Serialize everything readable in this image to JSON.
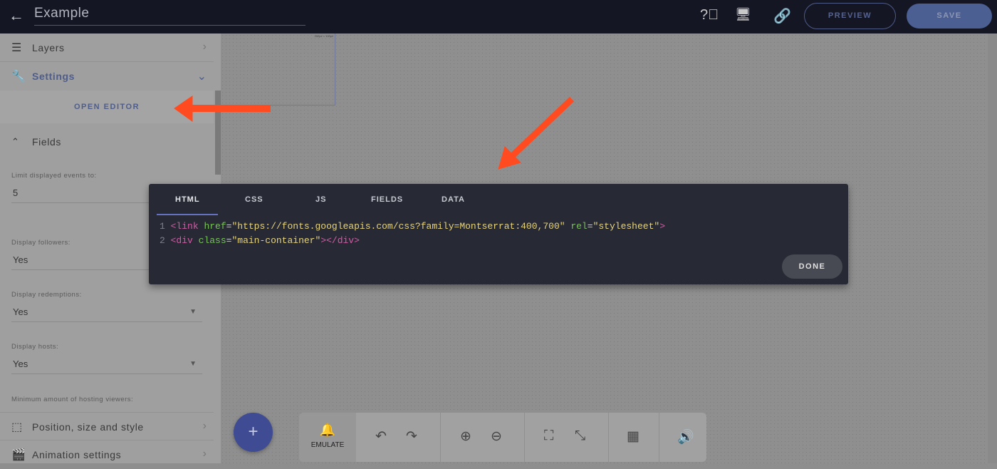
{
  "header": {
    "title": "Example",
    "back_icon": "arrow-left-icon",
    "preview_label": "PREVIEW",
    "save_label": "SAVE",
    "icons": [
      "help-icon",
      "monitor-settings-icon",
      "link-icon"
    ]
  },
  "sidebar": {
    "layers_label": "Layers",
    "settings_label": "Settings",
    "open_editor_label": "OPEN EDITOR",
    "fields_label": "Fields",
    "fields": [
      {
        "label": "Limit displayed events to:",
        "value": "5"
      },
      {
        "label": "Display followers:",
        "value": "Yes"
      },
      {
        "label": "Display redemptions:",
        "value": "Yes"
      },
      {
        "label": "Display hosts:",
        "value": "Yes"
      },
      {
        "label": "Minimum amount of hosting viewers:"
      }
    ],
    "position_label": "Position, size and style",
    "animation_label": "Animation settings"
  },
  "canvas": {
    "widget_size_label": "250px × 100px"
  },
  "editor": {
    "tabs": [
      "HTML",
      "CSS",
      "JS",
      "FIELDS",
      "DATA"
    ],
    "active_tab": "HTML",
    "lines": [
      {
        "n": "1",
        "tag_open": "<link ",
        "a1": "href",
        "q1": "\"https://fonts.googleapis.com/css?family=Montserrat:400,700\"",
        "a2": "rel",
        "q2": "\"stylesheet\"",
        "close": ">"
      },
      {
        "n": "2",
        "tag_open": "<div ",
        "a1": "class",
        "q1": "\"main-container\"",
        "close": "></div>"
      }
    ],
    "done_label": "DONE"
  },
  "toolbar": {
    "add_label": "+",
    "emulate_label": "EMULATE"
  },
  "colors": {
    "accent": "#4c5f92",
    "arrow": "#ff4b1f",
    "modal_bg": "#272a35"
  }
}
